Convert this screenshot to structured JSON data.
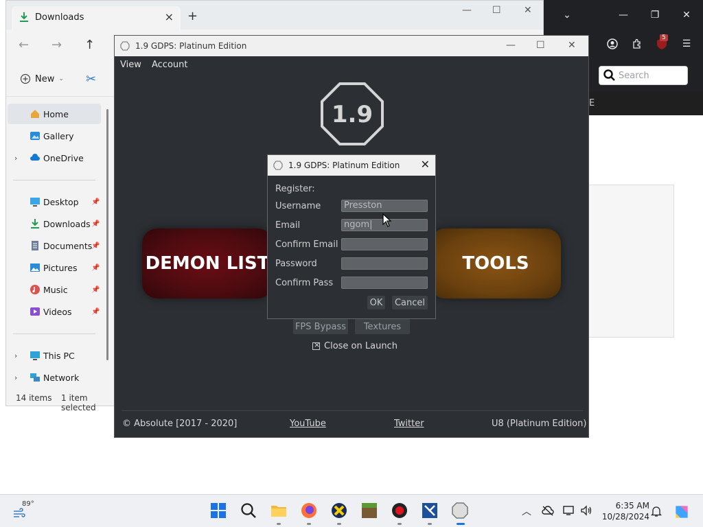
{
  "browser": {
    "search_placeholder": "Search",
    "dark_bar_text": "E",
    "extension_badge": "5"
  },
  "explorer": {
    "tab_title": "Downloads",
    "tab_close": "×",
    "new_tab": "+",
    "minimize": "—",
    "maximize": "☐",
    "close": "✕",
    "new_label": "New",
    "sidebar": {
      "home": "Home",
      "gallery": "Gallery",
      "onedrive": "OneDrive",
      "desktop": "Desktop",
      "downloads": "Downloads",
      "documents": "Documents",
      "pictures": "Pictures",
      "music": "Music",
      "videos": "Videos",
      "thispc": "This PC",
      "network": "Network"
    },
    "status": {
      "items": "14 items",
      "selected": "1 item selected"
    }
  },
  "launcher": {
    "title": "1.9 GDPS: Platinum Edition",
    "menu": [
      "View",
      "Account"
    ],
    "logo_text": "1.9",
    "demon_list": "DEMON LIST",
    "tools": "TOOLS",
    "fps_bypass": "FPS Bypass",
    "textures": "Textures",
    "close_on_launch": "Close on Launch",
    "footer": {
      "copyright": "© Absolute [2017 - 2020]",
      "youtube": "YouTube",
      "twitter": "Twitter",
      "version": "U8 (Platinum Edition)"
    }
  },
  "dialog": {
    "title": "1.9 GDPS: Platinum Edition",
    "close": "✕",
    "heading": "Register:",
    "fields": [
      {
        "label": "Username",
        "value": "Presston"
      },
      {
        "label": "Email",
        "value": "ngom|"
      },
      {
        "label": "Confirm Email",
        "value": ""
      },
      {
        "label": "Password",
        "value": ""
      },
      {
        "label": "Confirm Pass",
        "value": ""
      }
    ],
    "ok": "OK",
    "cancel": "Cancel"
  },
  "taskbar": {
    "temperature": "89°",
    "time": "6:35 AM",
    "date": "10/28/2024"
  },
  "colors": {
    "launcher_bg": "#2c3034",
    "demon_red": "#5a0b12",
    "tools_orange": "#7a4a10",
    "browser_dark": "#202124"
  }
}
